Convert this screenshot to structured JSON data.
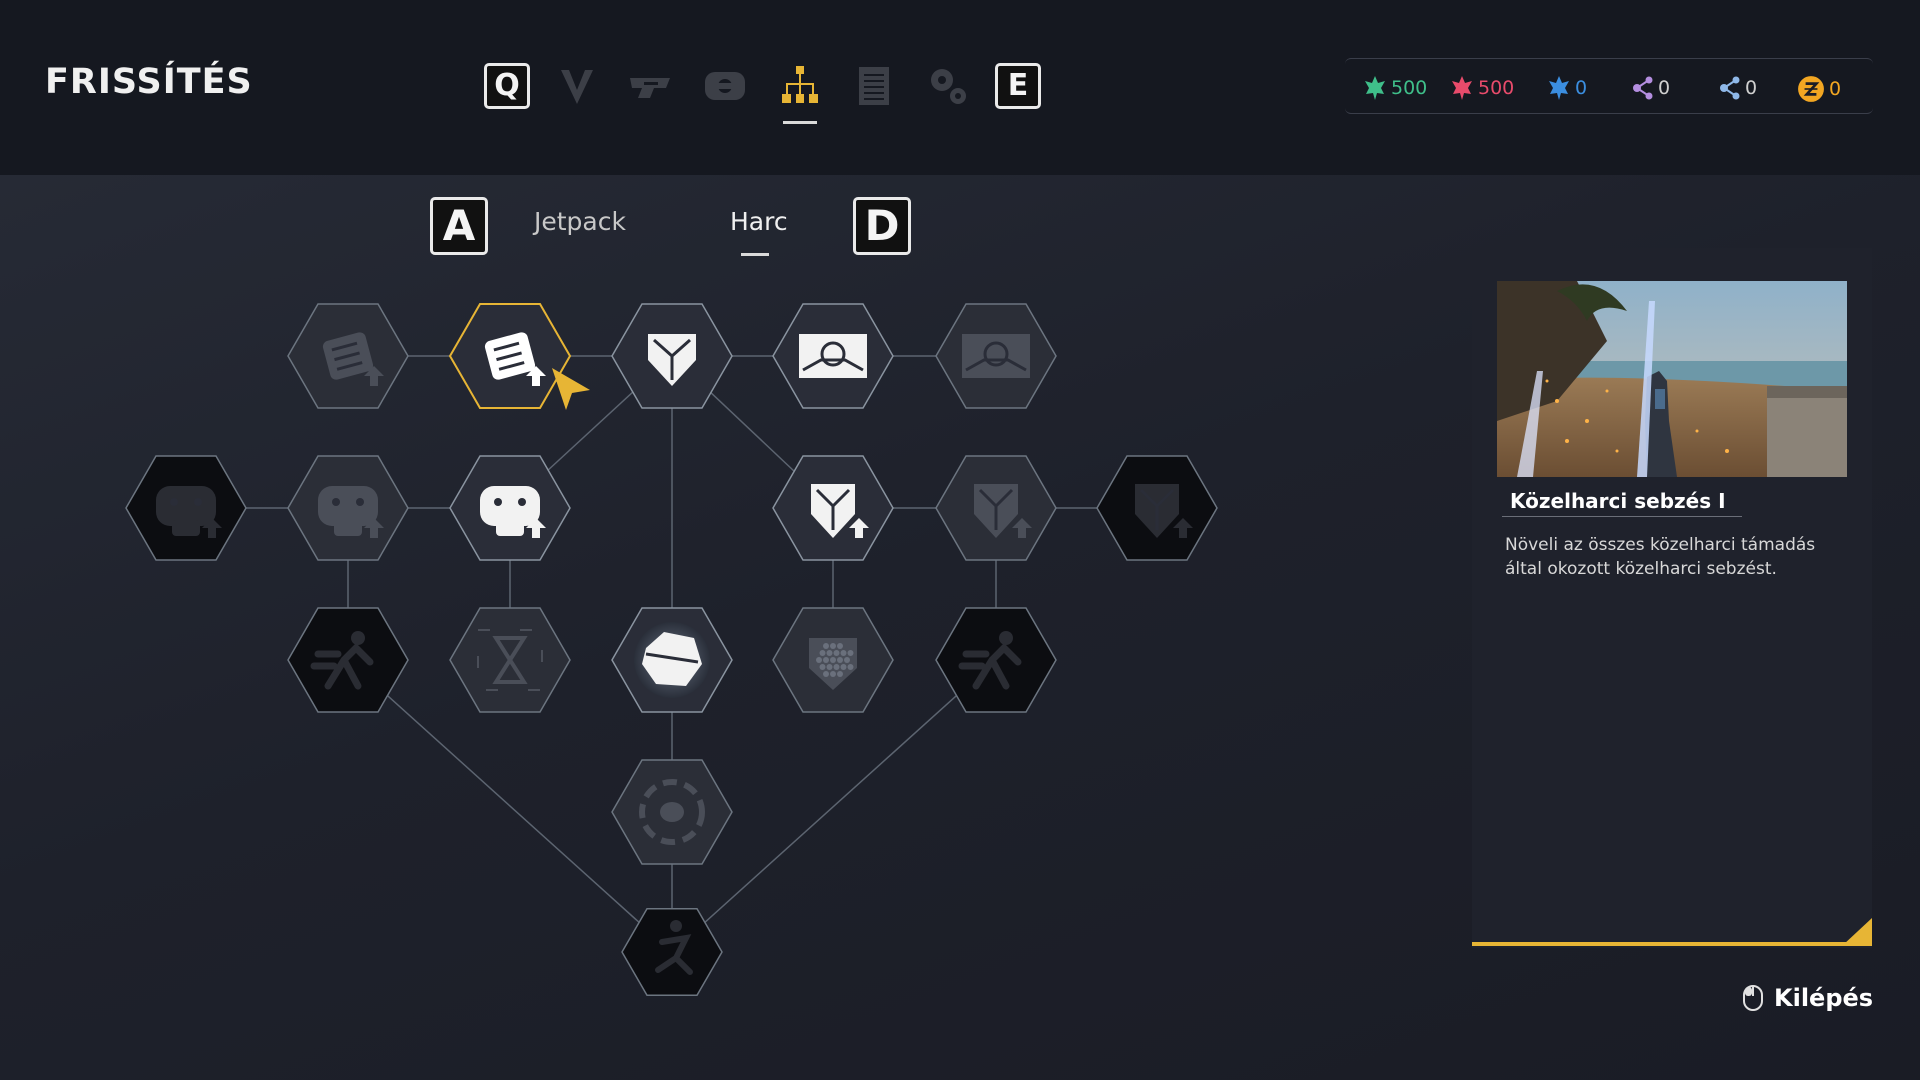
{
  "header": {
    "title": "FRISSÍTÉS"
  },
  "nav": {
    "key_left": "Q",
    "key_right": "E",
    "icons": [
      "chevron-down-icon",
      "weapon-icon",
      "armor-icon",
      "skill-tree-icon",
      "journal-icon",
      "settings-icon"
    ],
    "active_icon": "skill-tree-icon"
  },
  "currencies": [
    {
      "icon": "green-resource-icon",
      "value": "500",
      "color": "#3fbf8a"
    },
    {
      "icon": "red-resource-icon",
      "value": "500",
      "color": "#e84b6b"
    },
    {
      "icon": "blue-resource-icon",
      "value": "0",
      "color": "#3b8ee0"
    },
    {
      "icon": "purple-network-icon",
      "value": "0",
      "color": "#b48ee0"
    },
    {
      "icon": "lightblue-network-icon",
      "value": "0",
      "color": "#8fb8e8"
    },
    {
      "icon": "gold-coin-icon",
      "value": "0",
      "color": "#f2a622"
    }
  ],
  "subnav": {
    "key_left": "A",
    "key_right": "D",
    "tabs": [
      {
        "label": "Jetpack",
        "active": false
      },
      {
        "label": "Harc",
        "active": true
      }
    ]
  },
  "skill_tree": {
    "nodes": [
      {
        "id": "n1",
        "icon": "fist-upgrade-icon",
        "state": "locked"
      },
      {
        "id": "n2",
        "icon": "fist-upgrade-icon",
        "state": "selected"
      },
      {
        "id": "n3",
        "icon": "shield-icon",
        "state": "unlocked"
      },
      {
        "id": "n4",
        "icon": "gate-icon",
        "state": "unlocked"
      },
      {
        "id": "n5",
        "icon": "gate-icon",
        "state": "locked"
      },
      {
        "id": "n6",
        "icon": "bear-upgrade-icon",
        "state": "dark"
      },
      {
        "id": "n7",
        "icon": "bear-upgrade-icon",
        "state": "locked"
      },
      {
        "id": "n8",
        "icon": "bear-upgrade-icon",
        "state": "unlocked"
      },
      {
        "id": "n9",
        "icon": "shield-upgrade-icon",
        "state": "unlocked"
      },
      {
        "id": "n10",
        "icon": "shield-upgrade-icon",
        "state": "locked"
      },
      {
        "id": "n11",
        "icon": "shield-upgrade-icon",
        "state": "dark"
      },
      {
        "id": "n12",
        "icon": "dash-icon",
        "state": "dark"
      },
      {
        "id": "n13",
        "icon": "hourglass-icon",
        "state": "locked"
      },
      {
        "id": "n14",
        "icon": "orb-icon",
        "state": "unlocked"
      },
      {
        "id": "n15",
        "icon": "hex-shield-icon",
        "state": "locked"
      },
      {
        "id": "n16",
        "icon": "sprint-icon",
        "state": "dark"
      },
      {
        "id": "n17",
        "icon": "blade-vortex-icon",
        "state": "locked"
      },
      {
        "id": "n18",
        "icon": "leap-icon",
        "state": "dark"
      }
    ]
  },
  "detail": {
    "image": "skill-preview-image",
    "title": "Közelharci sebzés I",
    "description": "Növeli az összes közelharci támadás által okozott közelharci sebzést."
  },
  "footer": {
    "exit_icon": "mouse-icon",
    "exit_label": "Kilépés"
  }
}
